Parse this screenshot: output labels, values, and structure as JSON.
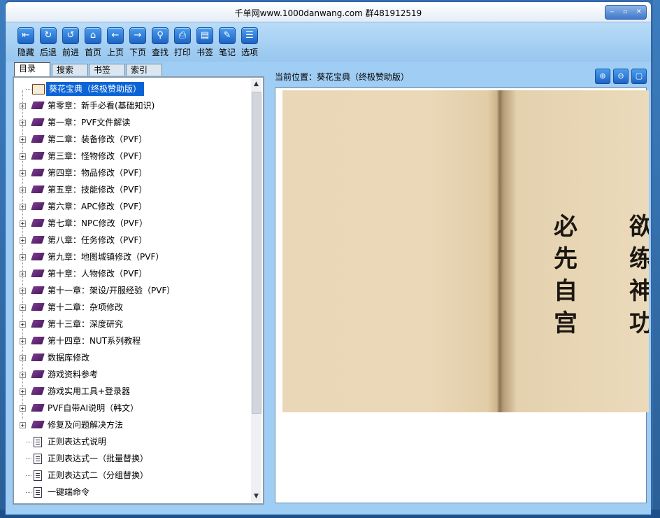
{
  "window": {
    "title": "千单网www.1000danwang.com 群481912519",
    "controls": [
      "‒",
      "▫",
      "✕"
    ]
  },
  "toolbar": {
    "buttons": [
      {
        "label": "隐藏",
        "icon": "hide-icon",
        "glyph": "⇤"
      },
      {
        "label": "后退",
        "icon": "back-circle-icon",
        "glyph": "↻"
      },
      {
        "label": "前进",
        "icon": "forward-circle-icon",
        "glyph": "↺"
      },
      {
        "label": "首页",
        "icon": "home-icon",
        "glyph": "⌂"
      },
      {
        "label": "上页",
        "icon": "arrow-left-icon",
        "glyph": "←"
      },
      {
        "label": "下页",
        "icon": "arrow-right-icon",
        "glyph": "→"
      },
      {
        "label": "查找",
        "icon": "search-icon",
        "glyph": "⚲"
      },
      {
        "label": "打印",
        "icon": "print-icon",
        "glyph": "⎙"
      },
      {
        "label": "书签",
        "icon": "bookmark-icon",
        "glyph": "▤"
      },
      {
        "label": "笔记",
        "icon": "note-icon",
        "glyph": "✎"
      },
      {
        "label": "选项",
        "icon": "options-icon",
        "glyph": "☰"
      }
    ]
  },
  "tabs": [
    "目录",
    "搜索",
    "书签",
    "索引"
  ],
  "tree": {
    "root": "葵花宝典（终极赞助版）",
    "chapters": [
      "第零章：新手必看(基础知识)",
      "第一章：PVF文件解读",
      "第二章：装备修改（PVF）",
      "第三章：怪物修改（PVF）",
      "第四章：物品修改（PVF）",
      "第五章：技能修改（PVF）",
      "第六章：APC修改（PVF）",
      "第七章：NPC修改（PVF）",
      "第八章：任务修改（PVF）",
      "第九章：地图城镇修改（PVF）",
      "第十章：人物修改（PVF）",
      "第十一章：架设/开服经验（PVF）",
      "第十二章：杂项修改",
      "第十三章：深度研究",
      "第十四章：NUT系列教程",
      "数据库修改",
      "游戏资料参考",
      "游戏实用工具+登录器",
      "PVF自带AI说明（韩文）",
      "修复及问题解决方法"
    ],
    "documents": [
      "正则表达式说明",
      "正则表达式一（批量替换）",
      "正则表达式二（分组替换）",
      "一键端命令"
    ]
  },
  "location": {
    "prefix": "当前位置：",
    "value": "葵花宝典（终极赞助版）"
  },
  "page_text": {
    "column_left": [
      "必",
      "先",
      "自",
      "宫"
    ],
    "column_right": [
      "欲",
      "练",
      "神",
      "功"
    ]
  }
}
